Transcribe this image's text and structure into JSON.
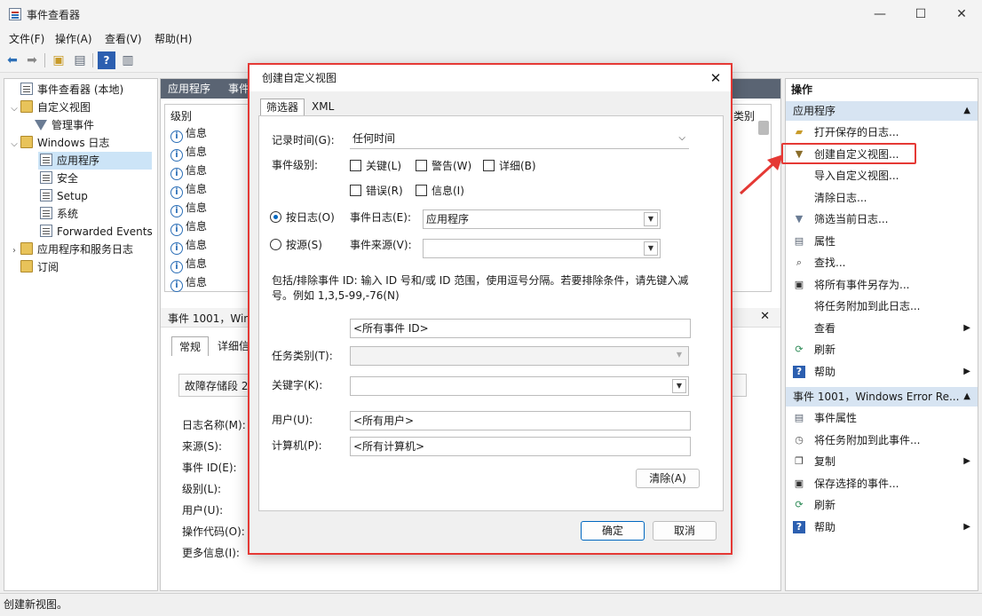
{
  "window": {
    "title": "事件查看器"
  },
  "menu": [
    "文件(F)",
    "操作(A)",
    "查看(V)",
    "帮助(H)"
  ],
  "tree": [
    {
      "label": "事件查看器 (本地)",
      "icon": "event-viewer-icon"
    },
    {
      "label": "自定义视图",
      "icon": "folder-icon"
    },
    {
      "label": "管理事件",
      "icon": "filter-icon"
    },
    {
      "label": "Windows 日志",
      "icon": "folder-icon"
    },
    {
      "label": "应用程序",
      "icon": "log-icon"
    },
    {
      "label": "安全",
      "icon": "log-icon"
    },
    {
      "label": "Setup",
      "icon": "log-icon"
    },
    {
      "label": "系统",
      "icon": "log-icon"
    },
    {
      "label": "Forwarded Events",
      "icon": "log-icon"
    },
    {
      "label": "应用程序和服务日志",
      "icon": "folder-icon"
    },
    {
      "label": "订阅",
      "icon": "folder-icon"
    }
  ],
  "middle": {
    "header_tab1": "应用程序",
    "header_tab2": "事件",
    "col_level": "级别",
    "col_category_partial": "类别",
    "rows": [
      "信息",
      "信息",
      "信息",
      "信息",
      "信息",
      "信息",
      "信息",
      "信息",
      "信息"
    ],
    "detail_title": "事件 1001，Wind",
    "detail_tabs": [
      "常规",
      "详细信"
    ],
    "detail_desc": "故障存储段 2",
    "fields": [
      "日志名称(M):",
      "来源(S):",
      "事件 ID(E):",
      "级别(L):",
      "用户(U):",
      "操作代码(O):",
      "更多信息(I):"
    ]
  },
  "actions": {
    "header": "操作",
    "section1": "应用程序",
    "items1": [
      "打开保存的日志...",
      "创建自定义视图...",
      "导入自定义视图...",
      "清除日志...",
      "筛选当前日志...",
      "属性",
      "查找...",
      "将所有事件另存为...",
      "将任务附加到此日志...",
      "查看",
      "刷新",
      "帮助"
    ],
    "section2": "事件 1001，Windows Error Re...",
    "items2": [
      "事件属性",
      "将任务附加到此事件...",
      "复制",
      "保存选择的事件...",
      "刷新",
      "帮助"
    ]
  },
  "status": "创建新视图。",
  "dialog": {
    "title": "创建自定义视图",
    "tab_filter": "筛选器",
    "tab_xml": "XML",
    "logged_label": "记录时间(G):",
    "logged_value": "任何时间",
    "level_label": "事件级别:",
    "levels": [
      "关键(L)",
      "警告(W)",
      "详细(B)",
      "错误(R)",
      "信息(I)"
    ],
    "by_log_label": "按日志(O)",
    "event_logs_label": "事件日志(E):",
    "event_logs_value": "应用程序",
    "by_source_label": "按源(S)",
    "sources_label": "事件来源(V):",
    "sources_value": "",
    "id_help": "包括/排除事件 ID: 输入 ID 号和/或 ID 范围，使用逗号分隔。若要排除条件，请先键入减号。例如 1,3,5-99,-76(N)",
    "id_value": "<所有事件 ID>",
    "task_label": "任务类别(T):",
    "keywords_label": "关键字(K):",
    "user_label": "用户(U):",
    "user_value": "<所有用户>",
    "computer_label": "计算机(P):",
    "computer_value": "<所有计算机>",
    "clear_label": "清除(A)",
    "ok_label": "确定",
    "cancel_label": "取消"
  },
  "colors": {
    "highlight": "#e53935",
    "accent": "#0067c0",
    "section": "#d7e4f2",
    "header_dark": "#5a6473"
  }
}
